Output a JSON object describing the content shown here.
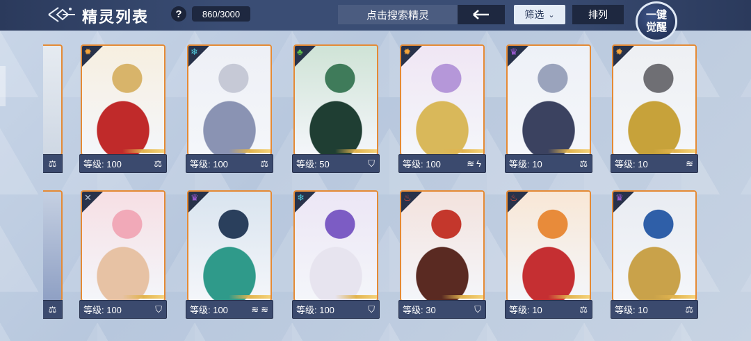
{
  "header": {
    "title": "精灵列表",
    "help": "?",
    "count": "860/3000",
    "search_placeholder": "点击搜索精灵",
    "filter_label": "筛选",
    "sort_label": "排列",
    "awaken_line1": "一键",
    "awaken_line2": "觉醒"
  },
  "colors": {
    "topbar": "#3a4d74",
    "card_border": "#e58a34",
    "card_footer": "#3b4a6e",
    "accent_gold": "#e2b44e"
  },
  "level_prefix": "等级:",
  "rows": [
    {
      "cards": [
        {
          "name": "blonde-prince",
          "attr": "light",
          "attr_color": "#f2a33a",
          "level": "100",
          "icons": [
            "scale-icon"
          ]
        },
        {
          "name": "white-haired-angel",
          "attr": "ice",
          "attr_color": "#4fc6d8",
          "level": "100",
          "icons": [
            "scale-icon"
          ]
        },
        {
          "name": "green-haired-warrior",
          "attr": "grass",
          "attr_color": "#5fbf4a",
          "level": "50",
          "icons": [
            "shield-icon"
          ]
        },
        {
          "name": "purple-haired-goddess",
          "attr": "light",
          "attr_color": "#f2a33a",
          "level": "100",
          "icons": [
            "claw-icon",
            "lightning-icon"
          ]
        },
        {
          "name": "grey-haired-scholar",
          "attr": "psychic",
          "attr_color": "#a15cd8",
          "level": "10",
          "icons": [
            "scale-icon"
          ]
        },
        {
          "name": "golden-dragon-knight",
          "attr": "light",
          "attr_color": "#f2a33a",
          "level": "10",
          "icons": [
            "claw-icon"
          ]
        }
      ]
    },
    {
      "cards": [
        {
          "name": "pink-bear-girl",
          "attr": "normal",
          "attr_color": "#b8c4d6",
          "level": "100",
          "icons": [
            "shield-icon"
          ]
        },
        {
          "name": "blue-haired-dragon-lord",
          "attr": "psychic",
          "attr_color": "#a15cd8",
          "level": "100",
          "icons": [
            "claw-icon",
            "claw-icon"
          ]
        },
        {
          "name": "purple-haired-dragon-maiden",
          "attr": "ice",
          "attr_color": "#4fc6d8",
          "level": "100",
          "icons": [
            "shield-icon"
          ]
        },
        {
          "name": "red-dragon-warrior",
          "attr": "fire",
          "attr_color": "#e84d3a",
          "level": "30",
          "icons": [
            "shield-icon"
          ]
        },
        {
          "name": "phoenix-maiden",
          "attr": "fire",
          "attr_color": "#e84d3a",
          "level": "10",
          "icons": [
            "scale-icon"
          ]
        },
        {
          "name": "blue-beast-king",
          "attr": "psychic",
          "attr_color": "#a15cd8",
          "level": "10",
          "icons": [
            "scale-icon"
          ]
        }
      ]
    }
  ]
}
